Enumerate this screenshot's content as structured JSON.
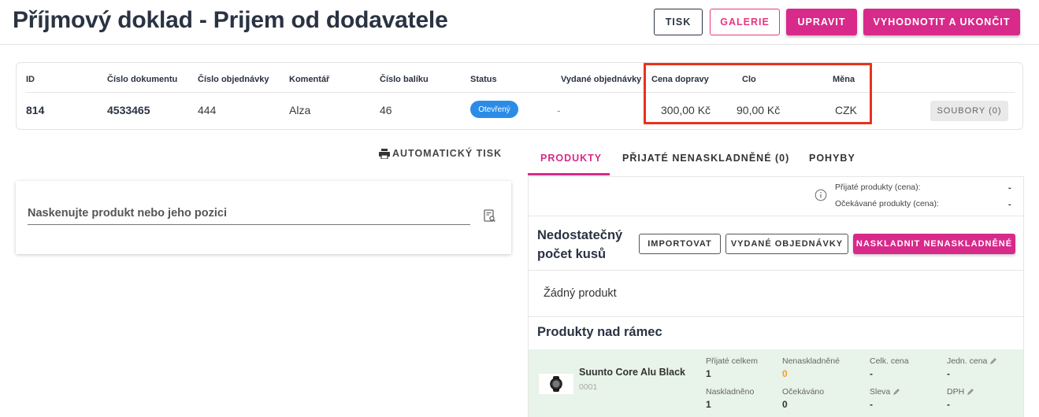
{
  "header": {
    "title": "Příjmový doklad - Prijem od dodavatele",
    "buttons": {
      "tisk": "TISK",
      "galerie": "GALERIE",
      "upravit": "UPRAVIT",
      "vyhodnotit": "VYHODNOTIT A UKONČIT"
    }
  },
  "info": {
    "columns": {
      "id": "ID",
      "cislo_dokumentu": "Číslo dokumentu",
      "cislo_objednavky": "Číslo objednávky",
      "komentar": "Komentář",
      "cislo_baliku": "Číslo balíku",
      "status": "Status",
      "vydane_objednavky": "Vydané objednávky",
      "cena_dopravy": "Cena dopravy",
      "clo": "Clo",
      "mena": "Měna"
    },
    "values": {
      "id": "814",
      "cislo_dokumentu": "4533465",
      "cislo_objednavky": "444",
      "komentar": "Alza",
      "cislo_baliku": "46",
      "status": "Otevřený",
      "vydane_objednavky": "-",
      "cena_dopravy": "300,00 Kč",
      "clo": "90,00 Kč",
      "mena": "CZK"
    },
    "soubory_button": "SOUBORY (0)",
    "status_color": "#2b8ce8",
    "highlight_color": "#e8321c"
  },
  "left": {
    "auto_print_label": "AUTOMATICKÝ TISK",
    "scan_placeholder": "Naskenujte produkt nebo jeho pozici"
  },
  "tabs": [
    {
      "label": "PRODUKTY",
      "active": true
    },
    {
      "label": "PŘIJATÉ NENASKLADNĚNÉ (0)",
      "active": false
    },
    {
      "label": "POHYBY",
      "active": false
    }
  ],
  "summary": {
    "received_label": "Přijaté produkty (cena):",
    "received_value": "-",
    "expected_label": "Očekávané produkty (cena):",
    "expected_value": "-"
  },
  "insufficient": {
    "title": "Nedostatečný počet kusů",
    "buttons": {
      "importovat": "IMPORTOVAT",
      "vydane": "VYDANÉ OBJEDNÁVKY",
      "naskladnit": "NASKLADNIT NENASKLADNĚNÉ"
    },
    "empty_text": "Žádný produkt"
  },
  "over_limit": {
    "title": "Produkty nad rámec",
    "product": {
      "name": "Suunto Core Alu Black",
      "code": "0001",
      "fields": {
        "prijate_celkem": {
          "label": "Přijaté celkem",
          "value": "1"
        },
        "nenaskladnene": {
          "label": "Nenaskladněné",
          "value": "0"
        },
        "celk_cena": {
          "label": "Celk. cena",
          "value": "-"
        },
        "jedn_cena": {
          "label": "Jedn. cena",
          "value": "-"
        },
        "naskladneno": {
          "label": "Naskladněno",
          "value": "1"
        },
        "ocekavano": {
          "label": "Očekáváno",
          "value": "0"
        },
        "sleva": {
          "label": "Sleva",
          "value": "-"
        },
        "dph": {
          "label": "DPH",
          "value": "-"
        }
      }
    }
  },
  "colors": {
    "accent": "#d82a8a",
    "title": "#2a3342",
    "product_bg": "#e8f3e9"
  }
}
